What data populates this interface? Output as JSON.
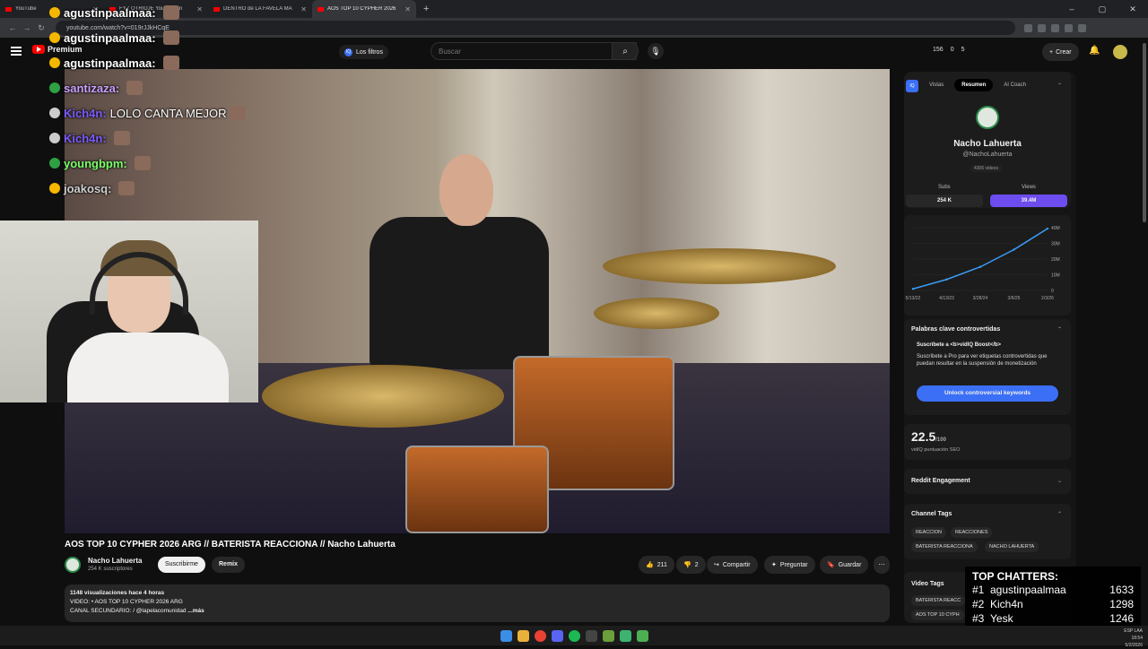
{
  "browser": {
    "tabs": [
      {
        "label": "YouTube",
        "active": false
      },
      {
        "label": "FYZ OTRIDJE Youtube en",
        "active": false
      },
      {
        "label": "DENTRO de LA FAVELA MÁ",
        "active": false
      },
      {
        "label": "AOS TOP 10 CYPHER 2026",
        "active": true
      }
    ],
    "url": "youtube.com/watch?v=019rJJkHCqE"
  },
  "header": {
    "logo": "Premium",
    "filters_label": "Los filtros",
    "search_placeholder": "Buscar",
    "stats": [
      "156",
      "0",
      "5"
    ],
    "create_label": "Crear"
  },
  "overlay_chat": [
    {
      "user": "agustinpaalmaa:",
      "msg": "",
      "color": "#ffffff",
      "badge_color": "#f5b700"
    },
    {
      "user": "agustinpaalmaa:",
      "msg": "",
      "color": "#ffffff",
      "badge_color": "#f5b700"
    },
    {
      "user": "agustinpaalmaa:",
      "msg": "",
      "color": "#ffffff",
      "badge_color": "#f5b700"
    },
    {
      "user": "santizaza:",
      "msg": "",
      "color": "#c9a0ff",
      "badge_color": "#2ea043"
    },
    {
      "user": "Kich4n:",
      "msg": "LOLO CANTA MEJOR",
      "color": "#7b5cff",
      "badge_color": "#cccccc"
    },
    {
      "user": "Kich4n:",
      "msg": "",
      "color": "#7b5cff",
      "badge_color": "#cccccc"
    },
    {
      "user": "youngbpm:",
      "msg": "",
      "color": "#7cff6b",
      "badge_color": "#2ea043"
    },
    {
      "user": "joakosq:",
      "msg": "",
      "color": "#d0d0d0",
      "badge_color": "#f5b700"
    }
  ],
  "video": {
    "title": "AOS TOP 10 CYPHER 2026 ARG // BATERISTA REACCIONA // Nacho Lahuerta",
    "channel": "Nacho Lahuerta",
    "subscribers": "254 K suscriptores",
    "subscribe_label": "Suscribirme",
    "remix_label": "Remix",
    "likes": "211",
    "dislikes": "2",
    "share_label": "Compartir",
    "ask_label": "Preguntar",
    "save_label": "Guardar",
    "desc_stats": "1148 visualizaciones  hace 4 horas",
    "desc_line1": "VIDEO: • AOS TOP 10 CYPHER 2026 ARG",
    "desc_line2": "CANAL SECUNDARIO: / @lapelacomunidad",
    "desc_more": "...más"
  },
  "vidiq": {
    "tabs": [
      "Vistas",
      "Resumen",
      "AI Coach"
    ],
    "channel_name": "Nacho Lahuerta",
    "handle": "@NachoLahuerta",
    "videos_count": "4306 videos",
    "subs_label": "Subs",
    "subs_value": "254 K",
    "views_label": "Views",
    "views_value": "39.4M",
    "kw_title": "Palabras clave controvertidas",
    "kw_sub": "Suscríbete a <b>vidIQ Boost</b>",
    "kw_desc": "Suscríbete a Pro para ver etiquetas controvertidas que puedan resultar en la suspensión de monetización",
    "unlock_label": "Unlock controversial keywords",
    "seo_score": "22.5",
    "seo_max": "/100",
    "seo_label": "vidIQ puntuación SEO",
    "reddit_label": "Reddit Engagement",
    "channel_tags_title": "Channel Tags",
    "channel_tags": [
      "REACCION",
      "REACCIONES",
      "BATERISTA REACCIONA",
      "NACHO LAHUERTA"
    ],
    "video_tags_title": "Video Tags",
    "video_tags": [
      "BATERISTA REACC",
      "AOS TOP 10 CYPH"
    ]
  },
  "chart_data": {
    "type": "line",
    "x": [
      "5/13/22",
      "4/13/23",
      "3/28/24",
      "3/6/25",
      "2/3/26"
    ],
    "y_ticks": [
      "0",
      "10M",
      "20M",
      "30M",
      "40M"
    ],
    "series": [
      {
        "values": [
          1,
          7,
          15,
          26,
          39.4
        ]
      }
    ],
    "ylim": [
      0,
      40
    ],
    "color": "#3b9cf5"
  },
  "top_chatters": {
    "title": "TOP CHATTERS:",
    "rows": [
      {
        "rank": "#1",
        "name": "agustinpaalmaa",
        "count": "1633"
      },
      {
        "rank": "#2",
        "name": "Kich4n",
        "count": "1298"
      },
      {
        "rank": "#3",
        "name": "Yesk",
        "count": "1246"
      }
    ]
  },
  "tray": {
    "lang": "ESP LAA",
    "time": "18:54",
    "date": "5/2/2026"
  }
}
